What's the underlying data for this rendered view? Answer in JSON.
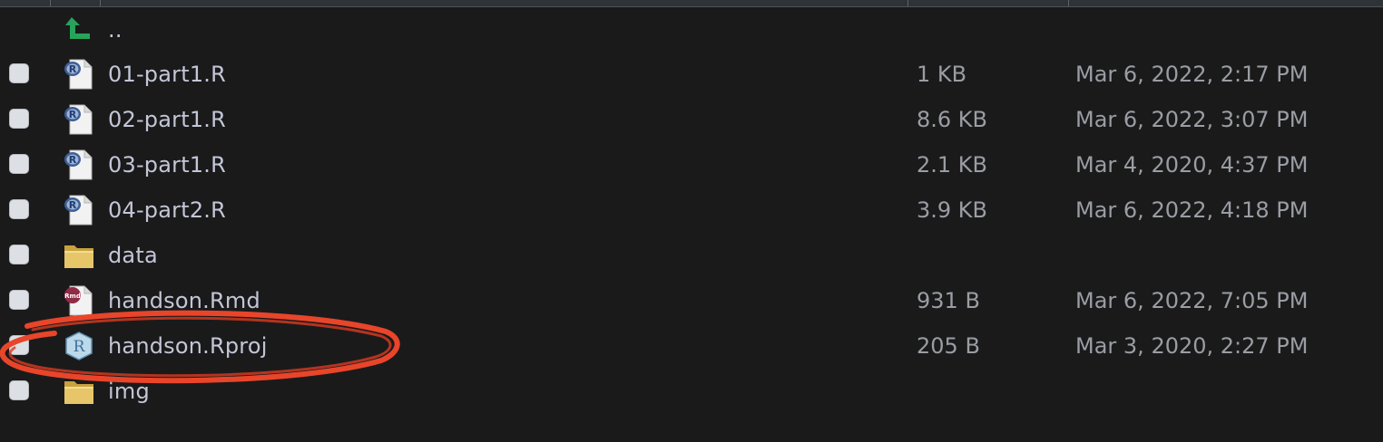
{
  "files": [
    {
      "name": "..",
      "icon": "parent-folder-icon",
      "size": "",
      "modified": ""
    },
    {
      "name": "01-part1.R",
      "icon": "r-script-icon",
      "size": "1 KB",
      "modified": "Mar 6, 2022, 2:17 PM"
    },
    {
      "name": "02-part1.R",
      "icon": "r-script-icon",
      "size": "8.6 KB",
      "modified": "Mar 6, 2022, 3:07 PM"
    },
    {
      "name": "03-part1.R",
      "icon": "r-script-icon",
      "size": "2.1 KB",
      "modified": "Mar 4, 2020, 4:37 PM"
    },
    {
      "name": "04-part2.R",
      "icon": "r-script-icon",
      "size": "3.9 KB",
      "modified": "Mar 6, 2022, 4:18 PM"
    },
    {
      "name": "data",
      "icon": "folder-icon",
      "size": "",
      "modified": ""
    },
    {
      "name": "handson.Rmd",
      "icon": "rmd-file-icon",
      "size": "931 B",
      "modified": "Mar 6, 2022, 7:05 PM"
    },
    {
      "name": "handson.Rproj",
      "icon": "rproj-file-icon",
      "size": "205 B",
      "modified": "Mar 3, 2020, 2:27 PM"
    },
    {
      "name": "img",
      "icon": "folder-icon",
      "size": "",
      "modified": ""
    }
  ],
  "colors": {
    "background": "#1a1a1b",
    "filename_text": "#c3c6d7",
    "meta_text": "#9a9da3",
    "annotation": "#e8452a",
    "parent_arrow": "#27a35a",
    "folder": "#e7c66a"
  }
}
